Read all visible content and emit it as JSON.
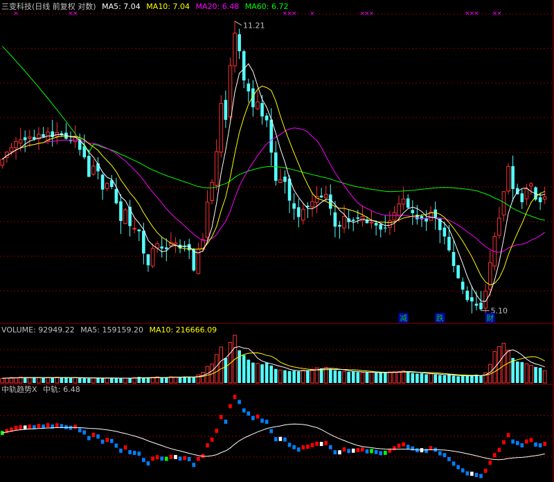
{
  "header": {
    "stock": "三变科技(日线 前复权 对数)",
    "ma5": "MA5: 7.04",
    "ma10": "MA10: 7.04",
    "ma20": "MA20: 6.48",
    "ma60": "MA60: 6.72"
  },
  "volume_header": {
    "volume": "VOLUME: 92949.22",
    "ma5": "MA5: 159159.20",
    "ma10": "MA10: 216666.09"
  },
  "trend_header": {
    "name": "中轨趋势X",
    "value": "中轨: 6.48"
  },
  "colors": {
    "up": "#ff3232",
    "down": "#54ffff",
    "ma5": "#ffffff",
    "ma10": "#ffff00",
    "ma20": "#ff00ff",
    "ma60": "#00ff00",
    "grid": "#8b0000",
    "text": "#c0c0c0",
    "volume_ma5": "#ffffff",
    "volume_ma10": "#ffff00",
    "trend_up": "#ff0000",
    "trend_down": "#0080ff",
    "trend_flat": "#00ff00",
    "trend_neutral": "#ffffff",
    "marker": "#ff00ff",
    "event": "#00cc00",
    "event_box": "#0000c0"
  },
  "chart_data": {
    "type": "candlestick",
    "scale": "log",
    "price_high_label": "11.21",
    "price_low_label": "5.10",
    "events": [
      {
        "label": "减",
        "at": 88
      },
      {
        "label": "跌",
        "at": 96
      },
      {
        "label": "财",
        "at": 107
      }
    ],
    "close": [
      7.7,
      7.85,
      7.95,
      8.08,
      8.12,
      8.11,
      8.18,
      8.13,
      8.24,
      8.18,
      8.29,
      8.18,
      8.28,
      8.22,
      8.14,
      8.09,
      8.17,
      7.9,
      7.74,
      7.34,
      7.56,
      7.45,
      7.09,
      7.21,
      7.14,
      6.83,
      6.51,
      6.71,
      6.42,
      6.38,
      6.33,
      5.96,
      5.77,
      6.04,
      6.12,
      6.04,
      6.03,
      6.14,
      6.13,
      6.04,
      6.07,
      6.01,
      5.69,
      6.03,
      6.19,
      6.85,
      7.23,
      7.86,
      8.96,
      8.57,
      9.93,
      10.85,
      10.33,
      9.54,
      9.26,
      8.87,
      9.0,
      8.65,
      8.56,
      7.84,
      7.26,
      7.28,
      7.24,
      6.88,
      6.73,
      6.58,
      6.72,
      6.76,
      6.86,
      6.96,
      6.94,
      7.0,
      6.73,
      6.41,
      6.41,
      6.59,
      6.49,
      6.51,
      6.55,
      6.59,
      6.47,
      6.49,
      6.43,
      6.36,
      6.38,
      6.51,
      6.66,
      6.82,
      6.91,
      6.75,
      6.65,
      6.54,
      6.54,
      6.5,
      6.67,
      6.57,
      6.35,
      6.24,
      6.01,
      5.76,
      5.57,
      5.4,
      5.25,
      5.23,
      5.17,
      5.12,
      5.38,
      5.81,
      6.24,
      6.56,
      7.05,
      7.55,
      7.1,
      7.0,
      6.85,
      7.1,
      7.2,
      6.9,
      6.85,
      6.95
    ],
    "series": [
      {
        "name": "MA5"
      },
      {
        "name": "MA10"
      },
      {
        "name": "MA20"
      },
      {
        "name": "MA60"
      }
    ],
    "volume": [
      35000,
      38000,
      42000,
      40000,
      45000,
      41000,
      39000,
      43000,
      40000,
      38000,
      42000,
      41000,
      44000,
      40000,
      39000,
      37000,
      42000,
      39000,
      36000,
      34000,
      38000,
      37000,
      35000,
      39000,
      38000,
      36000,
      34000,
      37000,
      36000,
      41000,
      46000,
      40000,
      38000,
      42000,
      46000,
      40000,
      43000,
      47000,
      45000,
      44000,
      48000,
      46000,
      41000,
      62000,
      81000,
      125000,
      143000,
      215000,
      272000,
      188000,
      307000,
      361000,
      247000,
      211000,
      176000,
      154000,
      148000,
      141000,
      152000,
      132000,
      106000,
      98000,
      96000,
      90000,
      92000,
      88000,
      97000,
      96000,
      104000,
      114000,
      111000,
      118000,
      106000,
      96000,
      91000,
      88000,
      84000,
      86000,
      82000,
      78000,
      82000,
      80000,
      77000,
      76000,
      78000,
      84000,
      86000,
      87000,
      92000,
      83000,
      75000,
      71000,
      74000,
      66000,
      69000,
      65000,
      60000,
      58000,
      61000,
      55000,
      50000,
      52000,
      54000,
      58000,
      63000,
      57000,
      78000,
      141000,
      239000,
      275000,
      301000,
      248000,
      189000,
      162000,
      158000,
      146000,
      133000,
      121000,
      115000,
      92949
    ]
  },
  "top_markers": [
    3,
    15,
    16,
    62,
    63,
    64,
    68,
    79,
    80,
    81,
    102,
    103,
    104,
    108,
    109,
    124,
    125,
    126,
    127,
    128,
    129
  ]
}
